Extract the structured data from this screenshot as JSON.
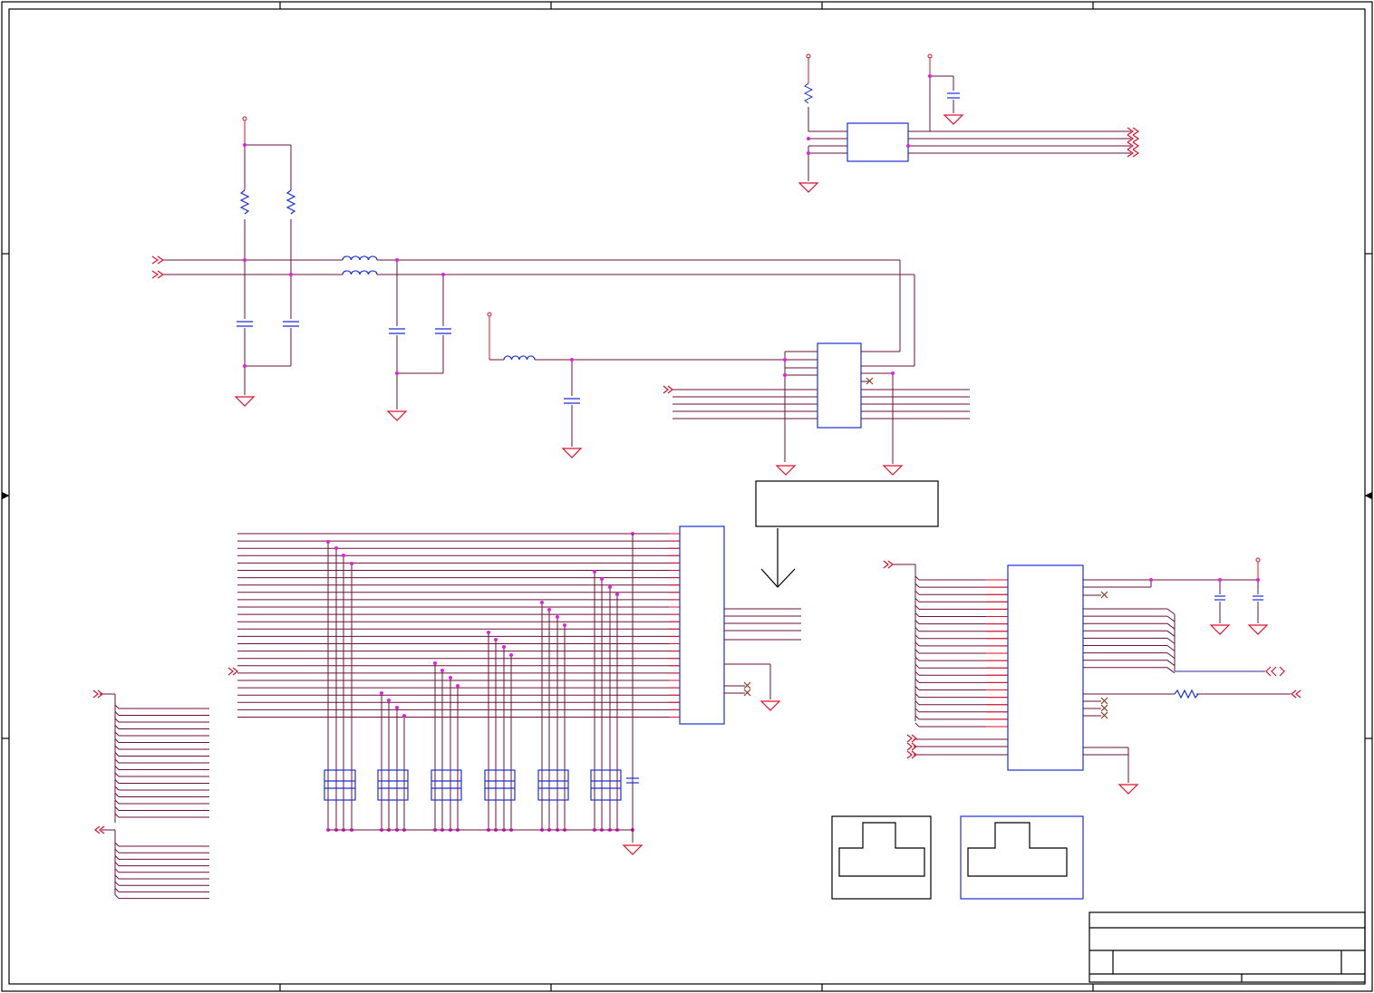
{
  "diagram": {
    "colors": {
      "background": "#ffffff",
      "wire": "#6b0f3a",
      "wire_highlight": "#e0102a",
      "component_outline": "#1a2fd6",
      "junction": "#e020e0",
      "power": "#e0102a",
      "no_connect": "#8a3a1a",
      "frame": "#000000"
    },
    "text_labels": []
  }
}
